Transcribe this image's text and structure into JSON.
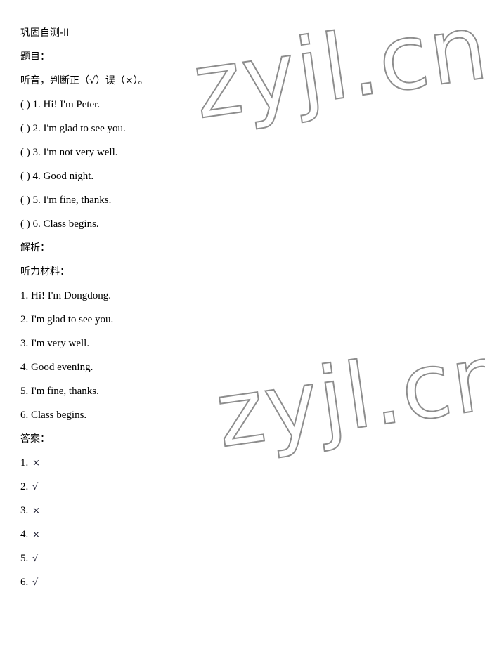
{
  "document": {
    "title": "巩固自测-II",
    "section_question_label": "题目：",
    "instruction": "听音，判断正（√）误（×）。",
    "section_analysis_label": "解析：",
    "section_listening_label": "听力材料：",
    "section_answer_label": "答案："
  },
  "questions": [
    {
      "bracket": "( )",
      "number": "1.",
      "text": "Hi! I'm Peter."
    },
    {
      "bracket": "( )",
      "number": "2.",
      "text": "I'm glad to see you."
    },
    {
      "bracket": "( )",
      "number": "3.",
      "text": "I'm not very well."
    },
    {
      "bracket": "( )",
      "number": "4.",
      "text": "Good night."
    },
    {
      "bracket": "( )",
      "number": "5.",
      "text": "I'm fine, thanks."
    },
    {
      "bracket": "( )",
      "number": "6.",
      "text": "Class begins."
    }
  ],
  "listening_material": [
    {
      "number": "1.",
      "text": "Hi! I'm Dongdong."
    },
    {
      "number": "2.",
      "text": "I'm glad to see you."
    },
    {
      "number": "3.",
      "text": "I'm very well."
    },
    {
      "number": "4.",
      "text": "Good evening."
    },
    {
      "number": "5.",
      "text": "I'm fine, thanks."
    },
    {
      "number": "6.",
      "text": "Class begins."
    }
  ],
  "answers": [
    {
      "number": "1.",
      "mark": "×"
    },
    {
      "number": "2.",
      "mark": "√"
    },
    {
      "number": "3.",
      "mark": "×"
    },
    {
      "number": "4.",
      "mark": "×"
    },
    {
      "number": "5.",
      "mark": "√"
    },
    {
      "number": "6.",
      "mark": "√"
    }
  ],
  "watermark": {
    "text": "zyjl.cn",
    "color": "#8d8d8d"
  }
}
